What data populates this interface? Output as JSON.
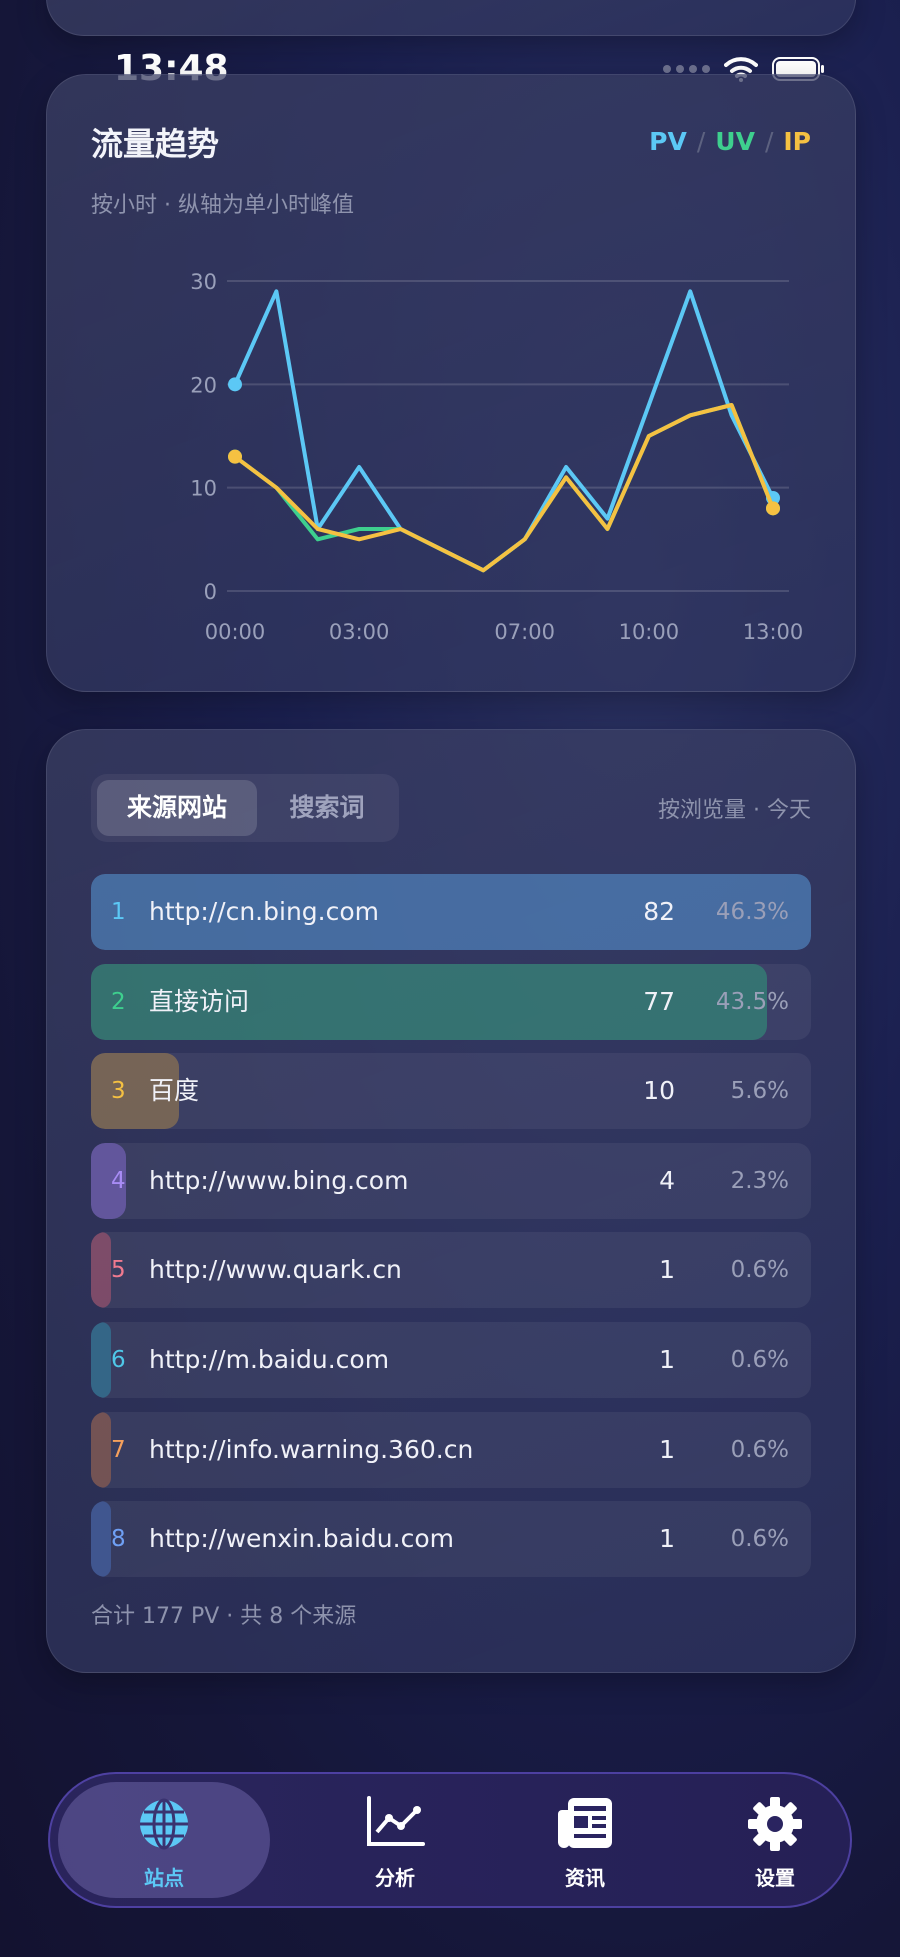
{
  "status_bar": {
    "time": "13:48"
  },
  "traffic_card": {
    "title": "流量趋势",
    "subtitle": "按小时 · 纵轴为单小时峰值",
    "legend": [
      {
        "label": "PV",
        "color": "#5cc8f5"
      },
      {
        "label": "UV",
        "color": "#3ecf8e"
      },
      {
        "label": "IP",
        "color": "#f5c142"
      }
    ]
  },
  "chart_data": {
    "type": "line",
    "x": [
      0,
      1,
      2,
      3,
      4,
      5,
      6,
      7,
      8,
      9,
      10,
      11,
      12,
      13
    ],
    "x_tick_labels": [
      {
        "x": 0,
        "label": "00:00"
      },
      {
        "x": 3,
        "label": "03:00"
      },
      {
        "x": 7,
        "label": "07:00"
      },
      {
        "x": 10,
        "label": "10:00"
      },
      {
        "x": 13,
        "label": "13:00"
      }
    ],
    "y_ticks": [
      0,
      10,
      20,
      30
    ],
    "ylim": [
      0,
      30
    ],
    "series": [
      {
        "name": "PV",
        "color": "#5cc8f5",
        "values": [
          20,
          29,
          6,
          12,
          6,
          4,
          2,
          5,
          12,
          7,
          18,
          29,
          17,
          9
        ]
      },
      {
        "name": "UV",
        "color": "#3ecf8e",
        "values": [
          13,
          10,
          5,
          6,
          6,
          4,
          2,
          5,
          11,
          6,
          15,
          17,
          18,
          8
        ]
      },
      {
        "name": "IP",
        "color": "#f5c142",
        "values": [
          13,
          10,
          6,
          5,
          6,
          4,
          2,
          5,
          11,
          6,
          15,
          17,
          18,
          8
        ]
      }
    ],
    "grid": true
  },
  "source_card": {
    "tabs": [
      "来源网站",
      "搜索词"
    ],
    "sort_note": "按浏览量 · 今天",
    "rows": [
      {
        "rank": "1",
        "name": "http://cn.bing.com",
        "count": "82",
        "pct": "46.3%",
        "share": 1.0,
        "color": "#4f8fd0"
      },
      {
        "rank": "2",
        "name": "直接访问",
        "count": "77",
        "pct": "43.5%",
        "share": 0.939,
        "color": "#2f9a7a"
      },
      {
        "rank": "3",
        "name": "百度",
        "count": "10",
        "pct": "5.6%",
        "share": 0.122,
        "color": "#b08a4a"
      },
      {
        "rank": "4",
        "name": "http://www.bing.com",
        "count": "4",
        "pct": "2.3%",
        "share": 0.049,
        "color": "#8a6ed8"
      },
      {
        "rank": "5",
        "name": "http://www.quark.cn",
        "count": "1",
        "pct": "0.6%",
        "share": 0.012,
        "color": "#c05a72"
      },
      {
        "rank": "6",
        "name": "http://m.baidu.com",
        "count": "1",
        "pct": "0.6%",
        "share": 0.012,
        "color": "#2f8fae"
      },
      {
        "rank": "7",
        "name": "http://info.warning.360.cn",
        "count": "1",
        "pct": "0.6%",
        "share": 0.012,
        "color": "#b06a4a"
      },
      {
        "rank": "8",
        "name": "http://wenxin.baidu.com",
        "count": "1",
        "pct": "0.6%",
        "share": 0.012,
        "color": "#4a72c0"
      }
    ],
    "rank_colors": [
      "#5cc8f5",
      "#3ecf8e",
      "#f5c142",
      "#a88cf5",
      "#f07a8f",
      "#4fc8e8",
      "#f5a05c",
      "#6fa0f5"
    ],
    "footnote": "合计 177 PV · 共 8 个来源"
  },
  "tabbar": {
    "items": [
      {
        "label": "站点",
        "icon": "globe-icon",
        "active": true
      },
      {
        "label": "分析",
        "icon": "line-chart-icon",
        "active": false
      },
      {
        "label": "资讯",
        "icon": "newspaper-icon",
        "active": false
      },
      {
        "label": "设置",
        "icon": "gear-icon",
        "active": false
      }
    ],
    "active_color": "#5cc8f5"
  }
}
